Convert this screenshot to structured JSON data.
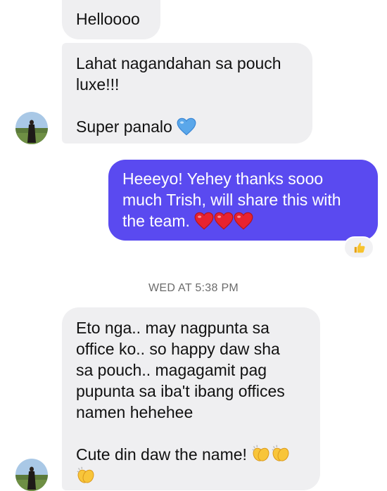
{
  "conversation": {
    "messages": [
      {
        "sender": "contact",
        "lines": [
          "Helloooo"
        ]
      },
      {
        "sender": "contact",
        "lines": [
          "Lahat nagandahan sa pouch",
          "luxe!!!",
          "",
          "Super panalo"
        ],
        "emoji": "blue-heart"
      },
      {
        "sender": "me",
        "lines": [
          "Heeeyo! Yehey thanks sooo",
          "much Trish, will share this with",
          "the team."
        ],
        "emoji": "red-hearts",
        "reaction": "thumbs-up"
      },
      {
        "sender": "contact",
        "lines": [
          "Eto nga.. may nagpunta sa",
          "office ko.. so happy daw sha",
          "sa pouch.. magagamit pag",
          "pupunta sa iba't ibang offices",
          "namen hehehee",
          "",
          "Cute din daw the name!"
        ],
        "emoji": "clapping-hands"
      }
    ],
    "timestamp": "WED AT 5:38 PM"
  },
  "colors": {
    "incoming_bubble": "#efeff1",
    "outgoing_bubble": "#5a4af0",
    "timestamp_text": "#6b6b6b"
  },
  "icons": {
    "contact_avatar": "avatar",
    "reaction": "thumbs-up-icon",
    "blue_heart": "blue-heart-icon",
    "red_heart": "red-heart-icon",
    "clap": "clapping-hands-icon"
  }
}
